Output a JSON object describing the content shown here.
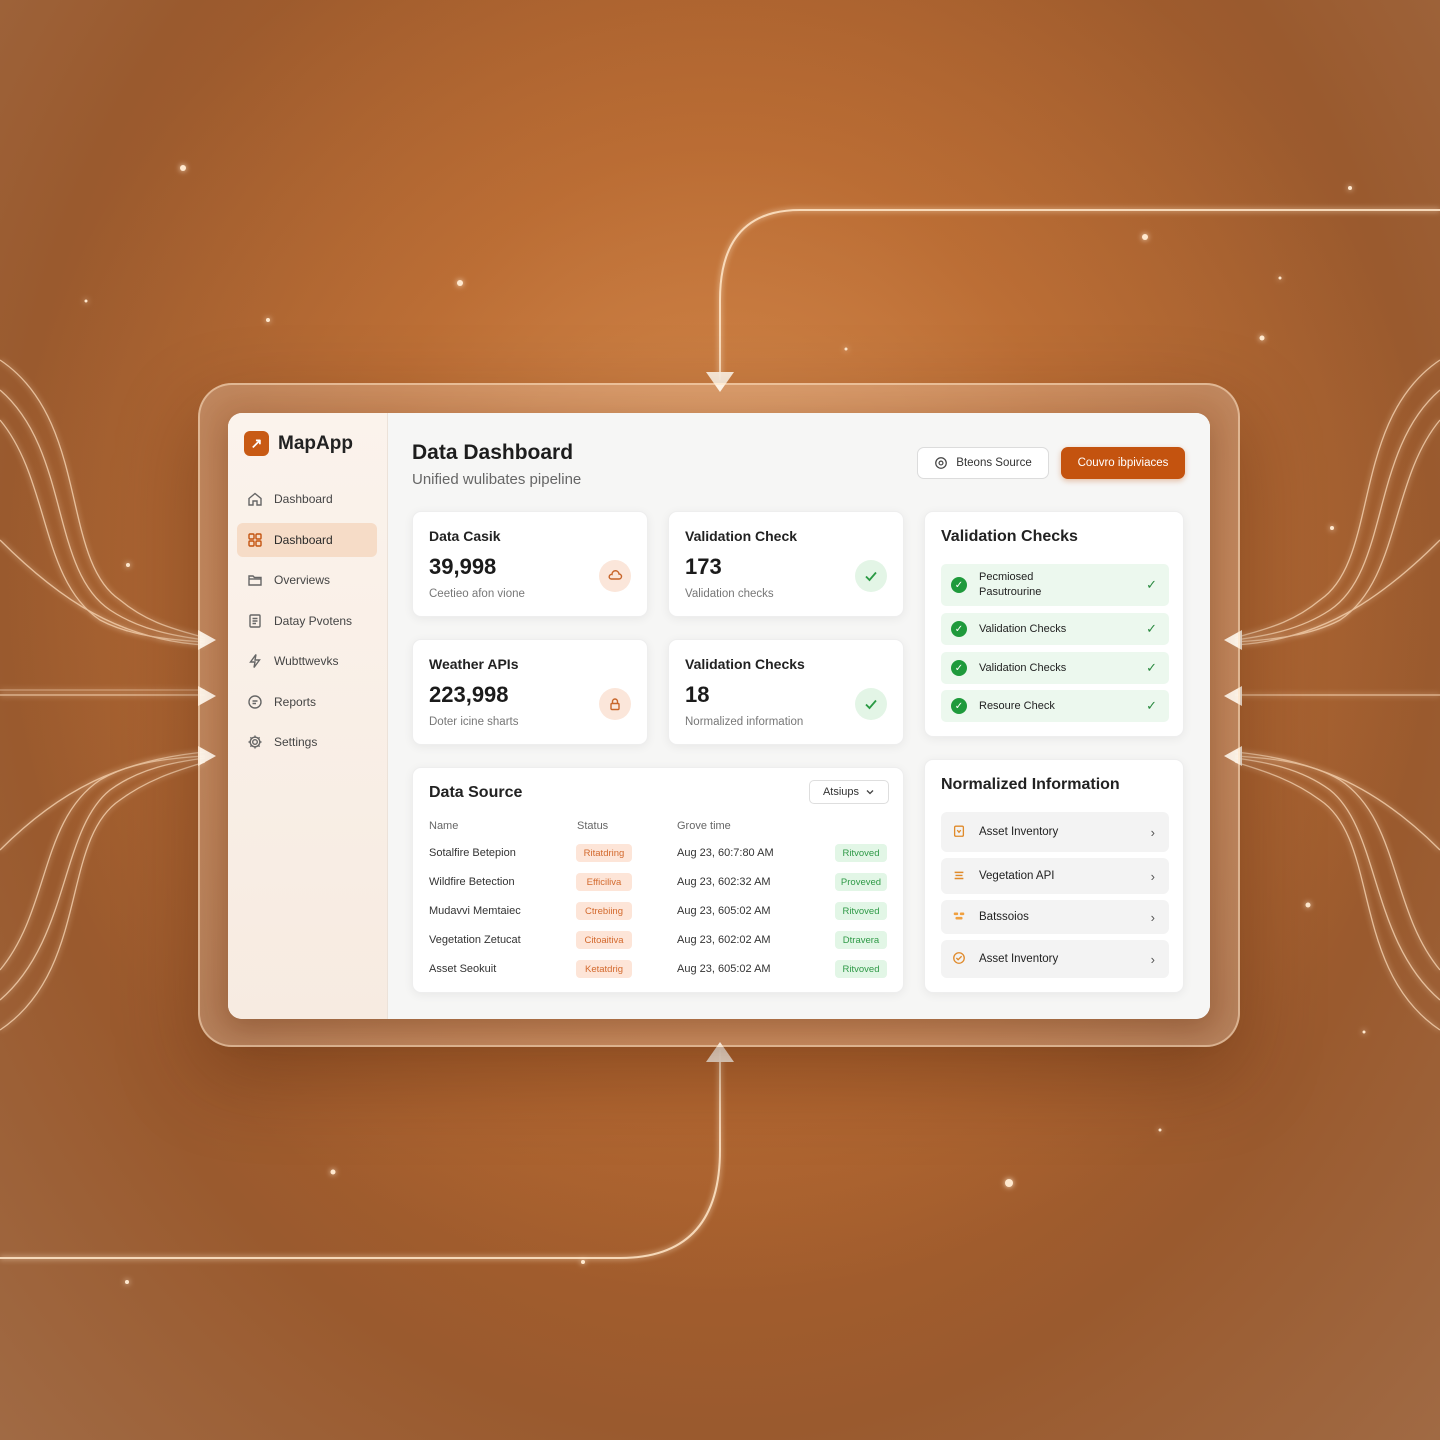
{
  "app": {
    "name": "MapApp",
    "logo_glyph": "↗"
  },
  "sidebar": {
    "items": [
      {
        "label": "Dashboard",
        "icon": "home-icon",
        "active": false
      },
      {
        "label": "Dashboard",
        "icon": "grid-icon",
        "active": true
      },
      {
        "label": "Overviews",
        "icon": "folder-icon",
        "active": false
      },
      {
        "label": "Datay Pvotens",
        "icon": "document-icon",
        "active": false
      },
      {
        "label": "Wubttwevks",
        "icon": "bolt-icon",
        "active": false
      },
      {
        "label": "Reports",
        "icon": "chat-icon",
        "active": false
      },
      {
        "label": "Settings",
        "icon": "gear-icon",
        "active": false
      }
    ]
  },
  "header": {
    "title": "Data Dashboard",
    "subtitle": "Unified wulibates pipeline",
    "secondary_button": "Bteons Source",
    "primary_button": "Couvro ibpiviaces"
  },
  "stats": [
    {
      "title": "Data Casik",
      "value": "39,998",
      "caption": "Ceetieo afon vione",
      "icon": "cloud-icon",
      "tone": "orange"
    },
    {
      "title": "Validation Check",
      "value": "173",
      "caption": "Validation checks",
      "icon": "check-icon",
      "tone": "green"
    },
    {
      "title": "Weather APIs",
      "value": "223,998",
      "caption": "Doter icine sharts",
      "icon": "lock-icon",
      "tone": "orange"
    },
    {
      "title": "Validation Checks",
      "value": "18",
      "caption": "Normalized information",
      "icon": "check-icon",
      "tone": "green"
    }
  ],
  "data_source": {
    "title": "Data Source",
    "dropdown": "Atsiups",
    "columns": [
      "Name",
      "Status",
      "Grove time"
    ],
    "rows": [
      {
        "name": "Sotalfire Betepion",
        "status": "Ritatdring",
        "time": "Aug 23, 60:7:80 AM",
        "result": "Ritvoved"
      },
      {
        "name": "Wildfire Betection",
        "status": "Efficiliva",
        "time": "Aug 23, 602:32 AM",
        "result": "Proveved"
      },
      {
        "name": "Mudavvi Memtaiec",
        "status": "Ctrebiing",
        "time": "Aug 23, 605:02 AM",
        "result": "Ritvoved"
      },
      {
        "name": "Vegetation Zetucat",
        "status": "Citoaitiva",
        "time": "Aug 23, 602:02 AM",
        "result": "Dtravera"
      },
      {
        "name": "Asset Seokuit",
        "status": "Ketatdrig",
        "time": "Aug 23, 605:02 AM",
        "result": "Ritvoved"
      }
    ]
  },
  "validation_panel": {
    "title": "Validation Checks",
    "items": [
      {
        "label": "Pecmiosed\nPasutrourine"
      },
      {
        "label": "Validation Checks"
      },
      {
        "label": "Validation Checks"
      },
      {
        "label": "Resoure Check"
      }
    ]
  },
  "info_panel": {
    "title": "Normalized Information",
    "items": [
      {
        "label": "Asset Inventory",
        "icon": "tag-icon"
      },
      {
        "label": "Vegetation API",
        "icon": "layers-icon"
      },
      {
        "label": "Batssoios",
        "icon": "stack-icon"
      },
      {
        "label": "Asset Inventory",
        "icon": "target-icon"
      }
    ]
  },
  "colors": {
    "accent": "#c4530f",
    "success": "#1f9a3c",
    "background": "#b0612a"
  }
}
